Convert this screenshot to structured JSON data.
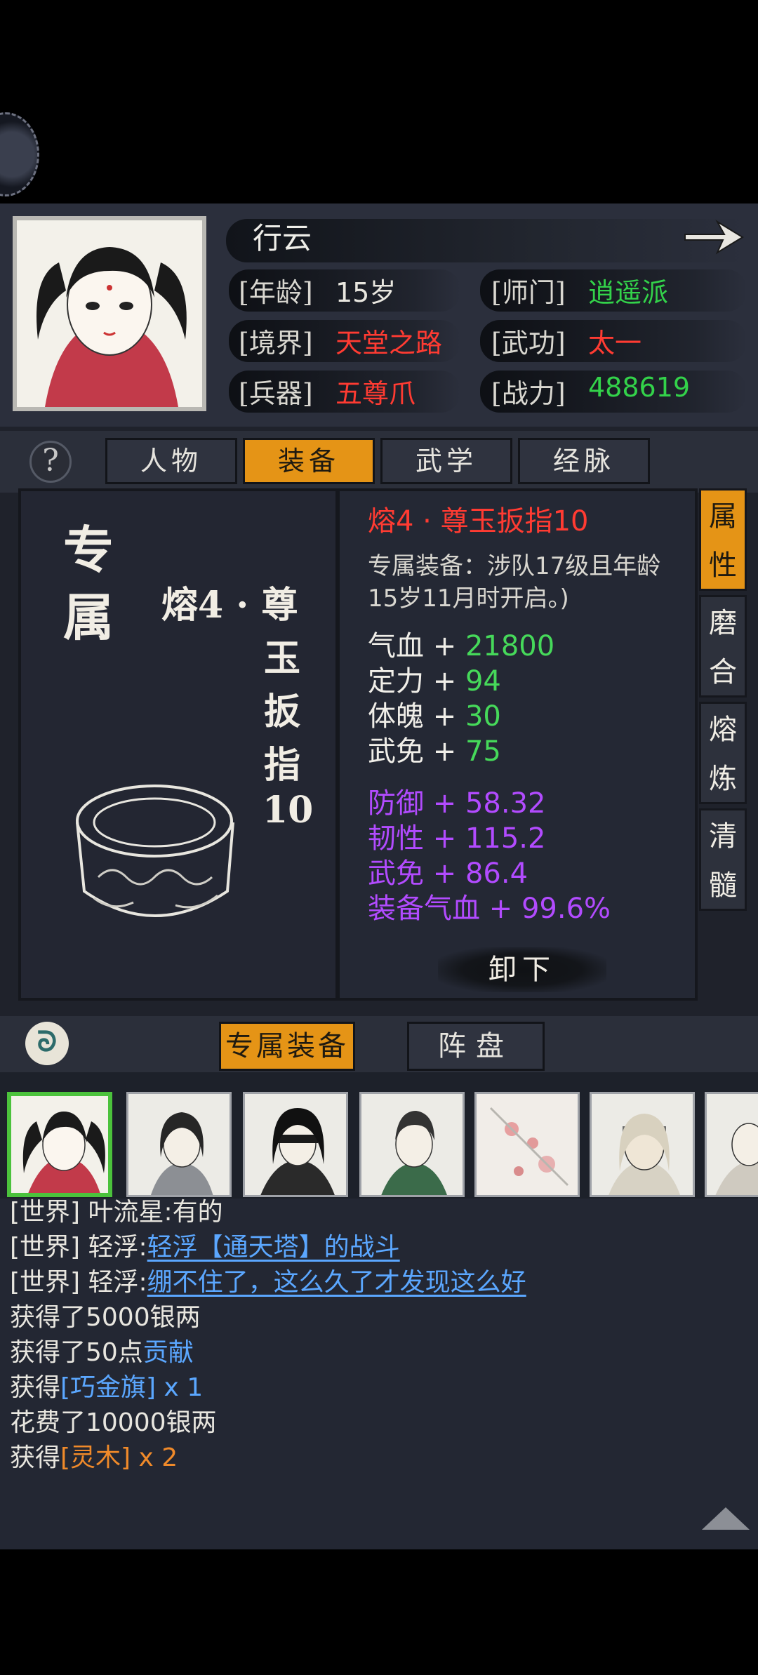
{
  "hero": {
    "name": "行云",
    "age_label": "[年龄]",
    "age_value": "15岁",
    "sect_label": "[师门]",
    "sect_value": "逍遥派",
    "realm_label": "[境界]",
    "realm_value": "天堂之路",
    "martial_label": "[武功]",
    "martial_value": "太一",
    "weapon_label": "[兵器]",
    "weapon_value": "五尊爪",
    "power_label": "[战力]",
    "power_value": "488619"
  },
  "tabs": [
    "人物",
    "装备",
    "武学",
    "经脉"
  ],
  "active_tab": "装备",
  "item": {
    "category_line1": "专",
    "category_line2": "属",
    "vertical_name": [
      "熔4 · 尊",
      "玉",
      "扳",
      "指",
      "10"
    ],
    "title": "熔4 · 尊玉扳指10",
    "description": "专属装备：涉队17级且年龄15岁11月时开启。)",
    "stats": [
      {
        "name": "气血",
        "sign": "+",
        "value": "21800"
      },
      {
        "name": "定力",
        "sign": "+",
        "value": "94"
      },
      {
        "name": "体魄",
        "sign": "+",
        "value": "30"
      },
      {
        "name": "武免",
        "sign": "+",
        "value": "75"
      }
    ],
    "bonus_stats": [
      {
        "name": "防御",
        "sign": "+",
        "value": "58.32"
      },
      {
        "name": "韧性",
        "sign": "+",
        "value": "115.2"
      },
      {
        "name": "武免",
        "sign": "+",
        "value": "86.4"
      },
      {
        "name": "装备气血",
        "sign": "+",
        "value": "99.6%"
      }
    ],
    "unequip_label": "卸下"
  },
  "side_tabs": [
    "属\n性",
    "磨\n合",
    "熔\n炼",
    "清\n髓"
  ],
  "bottom_tabs": {
    "exclusive": "专属装备",
    "formation": "阵盘"
  },
  "chat": {
    "lines": [
      {
        "prefix": "[世界] 叶流星:",
        "text": "有的"
      },
      {
        "prefix": "[世界] 轻浮:",
        "text": "轻浮【通天塔】的战斗"
      },
      {
        "prefix": "[世界] 轻浮:",
        "text": "绷不住了，这么久了才发现这么好"
      }
    ],
    "log": [
      {
        "a": "获得了5000银两"
      },
      {
        "a": "获得了50点",
        "b": "贡献"
      },
      {
        "a": "获得",
        "b": "[巧金旗]",
        "c": " x 1"
      },
      {
        "a": "花费了10000银两"
      },
      {
        "a": "获得",
        "b": "[灵木]",
        "c": " x 2"
      }
    ]
  },
  "colors": {
    "accent": "#e59416",
    "red": "#ff3b32",
    "green": "#33d24a",
    "purple": "#b24bff",
    "link": "#5ba7ff"
  }
}
